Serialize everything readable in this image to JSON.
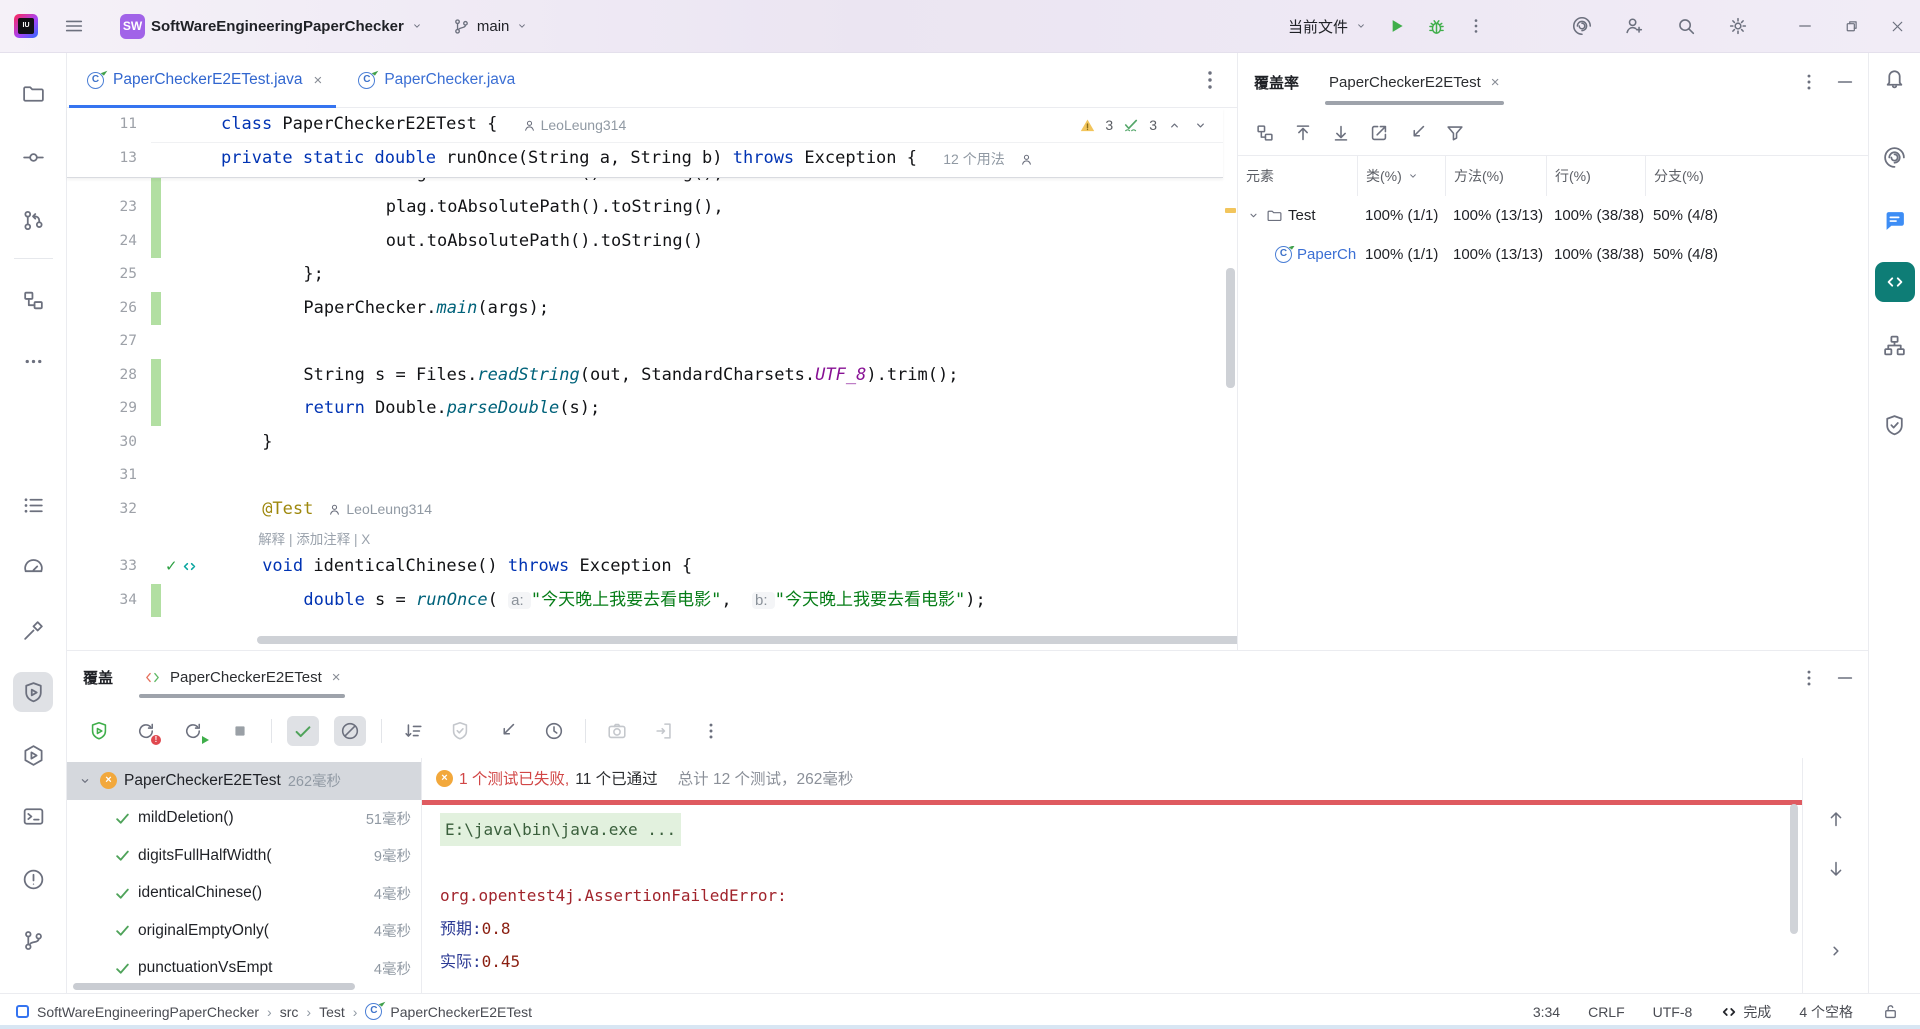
{
  "topbar": {
    "project": "SoftWareEngineeringPaperChecker",
    "avatar": "SW",
    "branch": "main",
    "run_config": "当前文件"
  },
  "editor": {
    "tabs": [
      {
        "label": "PaperCheckerE2ETest.java",
        "active": true,
        "closable": true
      },
      {
        "label": "PaperChecker.java",
        "active": false,
        "closable": false
      }
    ],
    "problems": {
      "warnings": "3",
      "passed": "3"
    },
    "sticky": [
      {
        "no": "11",
        "segments": [
          {
            "t": "class ",
            "c": "kw"
          },
          {
            "t": "PaperCheckerE2ETest { ",
            "c": "txt"
          }
        ],
        "author": "LeoLeung314"
      },
      {
        "no": "13",
        "segments": [
          {
            "t": "private static double ",
            "c": "kw"
          },
          {
            "t": "runOnce(String a, String b) ",
            "c": "txt"
          },
          {
            "t": "throws ",
            "c": "kw"
          },
          {
            "t": "Exception { ",
            "c": "txt"
          }
        ],
        "usages": "12 个用法"
      }
    ],
    "lines": [
      {
        "no": "",
        "cov": true,
        "indent": 16,
        "clip": true,
        "segments": [
          {
            "t": "orig.toAbsolutePath().toString(),",
            "c": "txt"
          }
        ]
      },
      {
        "no": "23",
        "cov": true,
        "indent": 16,
        "segments": [
          {
            "t": "plag.toAbsolutePath().toString(),",
            "c": "txt"
          }
        ]
      },
      {
        "no": "24",
        "cov": true,
        "indent": 16,
        "segments": [
          {
            "t": "out.toAbsolutePath().toString()",
            "c": "txt"
          }
        ]
      },
      {
        "no": "25",
        "cov": false,
        "indent": 8,
        "segments": [
          {
            "t": "};",
            "c": "txt"
          }
        ]
      },
      {
        "no": "26",
        "cov": true,
        "indent": 8,
        "segments": [
          {
            "t": "PaperChecker.",
            "c": "txt"
          },
          {
            "t": "main",
            "c": "smet"
          },
          {
            "t": "(args);",
            "c": "txt"
          }
        ]
      },
      {
        "no": "27",
        "cov": false,
        "indent": 0,
        "segments": []
      },
      {
        "no": "28",
        "cov": true,
        "indent": 8,
        "segments": [
          {
            "t": "String s = Files.",
            "c": "txt"
          },
          {
            "t": "readString",
            "c": "met"
          },
          {
            "t": "(out, StandardCharsets.",
            "c": "txt"
          },
          {
            "t": "UTF_8",
            "c": "const"
          },
          {
            "t": ").trim();",
            "c": "txt"
          }
        ]
      },
      {
        "no": "29",
        "cov": true,
        "indent": 8,
        "segments": [
          {
            "t": "return ",
            "c": "kw"
          },
          {
            "t": "Double.",
            "c": "txt"
          },
          {
            "t": "parseDouble",
            "c": "met"
          },
          {
            "t": "(s);",
            "c": "txt"
          }
        ]
      },
      {
        "no": "30",
        "cov": false,
        "indent": 4,
        "segments": [
          {
            "t": "}",
            "c": "txt"
          }
        ]
      },
      {
        "no": "31",
        "cov": false,
        "indent": 0,
        "segments": []
      },
      {
        "no": "32",
        "cov": false,
        "indent": 4,
        "segments": [
          {
            "t": "@Test",
            "c": "ann"
          }
        ],
        "author": "LeoLeung314"
      },
      {
        "no": "",
        "inlay": "解释 | 添加注释 | X",
        "indent": 4
      },
      {
        "no": "33",
        "cov": false,
        "indent": 4,
        "gutter": "run",
        "segments": [
          {
            "t": "void ",
            "c": "kw"
          },
          {
            "t": "identicalChinese() ",
            "c": "txt"
          },
          {
            "t": "throws ",
            "c": "kw"
          },
          {
            "t": "Exception {",
            "c": "txt"
          }
        ]
      },
      {
        "no": "34",
        "cov": true,
        "indent": 8,
        "segments": [
          {
            "t": "double ",
            "c": "kw"
          },
          {
            "t": "s = ",
            "c": "txt"
          },
          {
            "t": "runOnce",
            "c": "smet"
          },
          {
            "t": "( ",
            "c": "txt"
          },
          {
            "t": "a: ",
            "c": "hint"
          },
          {
            "t": "\"今天晚上我要去看电影\"",
            "c": "str"
          },
          {
            "t": ",  ",
            "c": "txt"
          },
          {
            "t": "b: ",
            "c": "hint"
          },
          {
            "t": "\"今天晚上我要去看电影\"",
            "c": "str"
          },
          {
            "t": ");",
            "c": "txt"
          }
        ]
      }
    ]
  },
  "coverage_panel": {
    "title": "覆盖率",
    "tab": "PaperCheckerE2ETest",
    "columns": [
      "元素",
      "类(%)",
      "方法(%)",
      "行(%)",
      "分支(%)"
    ],
    "rows": [
      {
        "name": "Test",
        "type": "folder",
        "values": [
          "100% (1/1)",
          "100% (13/13)",
          "100% (38/38)",
          "50% (4/8)"
        ]
      },
      {
        "name": "PaperCh",
        "type": "class",
        "values": [
          "100% (1/1)",
          "100% (13/13)",
          "100% (38/38)",
          "50% (4/8)"
        ]
      }
    ]
  },
  "bottom_panel": {
    "title": "覆盖",
    "tab": "PaperCheckerE2ETest",
    "tree": [
      {
        "label": "PaperCheckerE2ETest",
        "time": "262毫秒",
        "state": "failed",
        "root": true,
        "selected": true
      },
      {
        "label": "mildDeletion()",
        "time": "51毫秒",
        "state": "passed"
      },
      {
        "label": "digitsFullHalfWidth(",
        "time": "9毫秒",
        "state": "passed"
      },
      {
        "label": "identicalChinese()",
        "time": "4毫秒",
        "state": "passed"
      },
      {
        "label": "originalEmptyOnly(",
        "time": "4毫秒",
        "state": "passed"
      },
      {
        "label": "punctuationVsEmpt",
        "time": "4毫秒",
        "state": "passed"
      }
    ],
    "summary": {
      "failed": "1 个测试已失败,",
      "passed": "11 个已通过",
      "total": "总计 12 个测试，262毫秒"
    },
    "console": [
      [
        {
          "t": "E:\\java\\bin\\java.exe ...",
          "c": "cmd"
        }
      ],
      [],
      [
        {
          "t": "org.opentest4j.AssertionFailedError:",
          "c": "err"
        }
      ],
      [
        {
          "t": "预期:",
          "c": "lbl2"
        },
        {
          "t": "0.8",
          "c": "val"
        }
      ],
      [
        {
          "t": "实际:",
          "c": "lbl2"
        },
        {
          "t": "0.45",
          "c": "val"
        }
      ]
    ]
  },
  "statusbar": {
    "breadcrumbs": [
      "SoftWareEngineeringPaperChecker",
      "src",
      "Test",
      "PaperCheckerE2ETest"
    ],
    "caret": "3:34",
    "line_ending": "CRLF",
    "encoding": "UTF-8",
    "analysis": "完成",
    "indent": "4 个空格"
  }
}
